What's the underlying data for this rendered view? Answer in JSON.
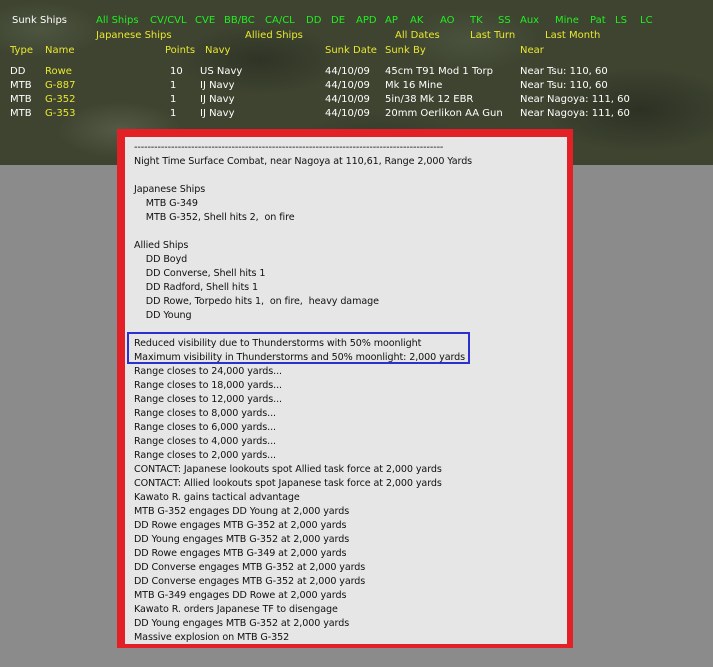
{
  "header": {
    "title": "Sunk Ships",
    "filters_row1": [
      "All Ships",
      "CV/CVL",
      "CVE",
      "BB/BC",
      "CA/CL",
      "DD",
      "DE",
      "APD",
      "AP",
      "AK",
      "AO",
      "TK",
      "SS",
      "Aux",
      "Mine",
      "Pat",
      "LS",
      "LC"
    ],
    "filters_row2": [
      "Japanese Ships",
      "Allied Ships",
      "All Dates",
      "Last Turn",
      "Last Month"
    ]
  },
  "table": {
    "columns": [
      "Type",
      "Name",
      "Points",
      "Navy",
      "Sunk Date",
      "Sunk By",
      "Near"
    ],
    "rows": [
      [
        "DD",
        "Rowe",
        "10",
        "US Navy",
        "44/10/09",
        "45cm T91 Mod 1 Torp",
        "Near Tsu: 110, 60"
      ],
      [
        "MTB",
        "G-887",
        "1",
        "IJ Navy",
        "44/10/09",
        "Mk 16 Mine",
        "Near Tsu: 110, 60"
      ],
      [
        "MTB",
        "G-352",
        "1",
        "IJ Navy",
        "44/10/09",
        "5in/38 Mk 12 EBR",
        "Near Nagoya: 111, 60"
      ],
      [
        "MTB",
        "G-353",
        "1",
        "IJ Navy",
        "44/10/09",
        "20mm Oerlikon AA Gun",
        "Near Nagoya: 111, 60"
      ]
    ]
  },
  "report": {
    "lines": [
      "--------------------------------------------------------------------------------------------",
      "Night Time Surface Combat, near Nagoya at 110,61, Range 2,000 Yards",
      "",
      "Japanese Ships",
      "    MTB G-349",
      "    MTB G-352, Shell hits 2,  on fire",
      "",
      "Allied Ships",
      "    DD Boyd",
      "    DD Converse, Shell hits 1",
      "    DD Radford, Shell hits 1",
      "    DD Rowe, Torpedo hits 1,  on fire,  heavy damage",
      "    DD Young",
      "",
      "Reduced visibility due to Thunderstorms with 50% moonlight",
      "Maximum visibility in Thunderstorms and 50% moonlight: 2,000 yards",
      "Range closes to 24,000 yards...",
      "Range closes to 18,000 yards...",
      "Range closes to 12,000 yards...",
      "Range closes to 8,000 yards...",
      "Range closes to 6,000 yards...",
      "Range closes to 4,000 yards...",
      "Range closes to 2,000 yards...",
      "CONTACT: Japanese lookouts spot Allied task force at 2,000 yards",
      "CONTACT: Allied lookouts spot Japanese task force at 2,000 yards",
      "Kawato R. gains tactical advantage",
      "MTB G-352 engages DD Young at 2,000 yards",
      "DD Rowe engages MTB G-352 at 2,000 yards",
      "DD Young engages MTB G-352 at 2,000 yards",
      "DD Rowe engages MTB G-349 at 2,000 yards",
      "DD Converse engages MTB G-352 at 2,000 yards",
      "DD Converse engages MTB G-352 at 2,000 yards",
      "MTB G-349 engages DD Rowe at 2,000 yards",
      "Kawato R. orders Japanese TF to disengage",
      "DD Young engages MTB G-352 at 2,000 yards",
      "Massive explosion on MTB G-352"
    ]
  }
}
